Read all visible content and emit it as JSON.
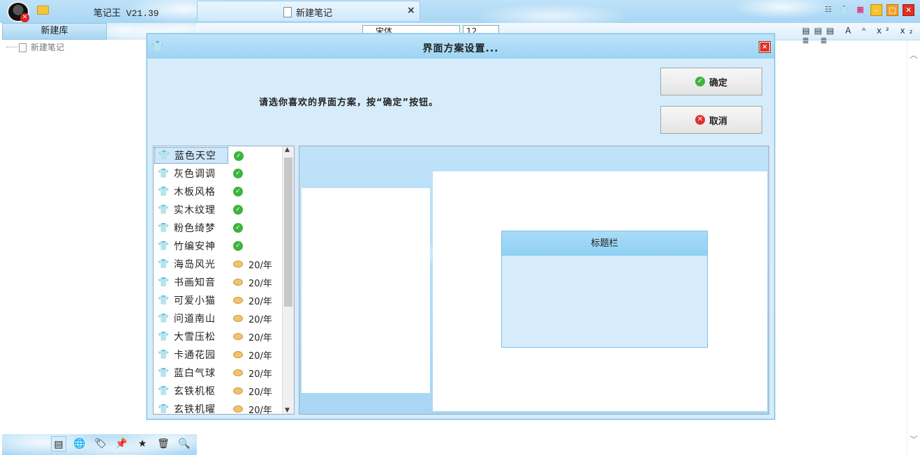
{
  "app": {
    "title": "笔记王 V21.39"
  },
  "tab": {
    "label": "新建笔记",
    "close": "×"
  },
  "sidebar": {
    "library_header": "新建库",
    "tree_item": "新建笔记"
  },
  "toolbar": {
    "font": "宋体",
    "size": "12"
  },
  "dialog": {
    "title": "界面方案设置...",
    "prompt": "请选你喜欢的界面方案，按“确定”按钮。",
    "ok_label": "确定",
    "cancel_label": "取消",
    "close": "×",
    "skins": [
      {
        "name": "蓝色天空",
        "status": "owned"
      },
      {
        "name": "灰色调调",
        "status": "owned"
      },
      {
        "name": "木板风格",
        "status": "owned"
      },
      {
        "name": "实木纹理",
        "status": "owned"
      },
      {
        "name": "粉色绮梦",
        "status": "owned"
      },
      {
        "name": "竹编安神",
        "status": "owned"
      },
      {
        "name": "海岛风光",
        "status": "price",
        "price": "20/年"
      },
      {
        "name": "书画知音",
        "status": "price",
        "price": "20/年"
      },
      {
        "name": "可爱小猫",
        "status": "price",
        "price": "20/年"
      },
      {
        "name": "问道南山",
        "status": "price",
        "price": "20/年"
      },
      {
        "name": "大雪压松",
        "status": "price",
        "price": "20/年"
      },
      {
        "name": "卡通花园",
        "status": "price",
        "price": "20/年"
      },
      {
        "name": "蓝白气球",
        "status": "price",
        "price": "20/年"
      },
      {
        "name": "玄铁机枢",
        "status": "price",
        "price": "20/年"
      },
      {
        "name": "玄铁机曜",
        "status": "price",
        "price": "20/年"
      }
    ],
    "preview": {
      "title_bar": "标题栏"
    }
  },
  "colors": {
    "accent": "#a8d6f4",
    "ok": "#3db43d",
    "cancel": "#e03030"
  }
}
